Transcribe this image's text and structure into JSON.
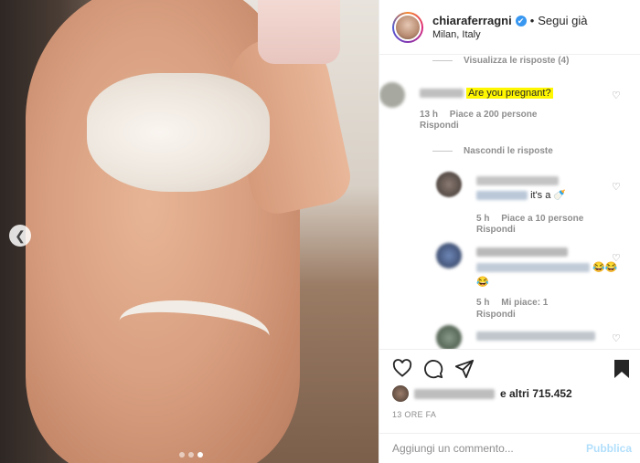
{
  "post": {
    "username": "chiaraferragni",
    "verified_mark": "✔",
    "separator": "•",
    "follow_status": "Segui già",
    "location": "Milan, Italy"
  },
  "comments": {
    "view_replies": "Visualizza le risposte (4)",
    "hide_replies": "Nascondi le risposte",
    "main": {
      "text": "Are you pregnant?",
      "time": "13 h",
      "likes": "Piace a 200 persone",
      "reply": "Rispondi"
    },
    "replies": [
      {
        "text": "it's a",
        "emoji": "🍼",
        "time": "5 h",
        "likes": "Piace a 10 persone",
        "reply": "Rispondi"
      },
      {
        "emoji": "😂😂",
        "emoji2": "😂",
        "time": "5 h",
        "likes": "Mi piace: 1",
        "reply": "Rispondi"
      }
    ]
  },
  "likes_summary": "e altri 715.452",
  "timestamp": "13 ORE FA",
  "add_comment": {
    "placeholder": "Aggiungi un commento...",
    "publish": "Pubblica"
  },
  "icons": {
    "heart": "heart-icon",
    "comment": "comment-icon",
    "share": "share-icon",
    "save": "bookmark-icon",
    "prev": "chevron-left-icon"
  },
  "colors": {
    "verified": "#3897f0",
    "highlight": "#fff700",
    "publish": "#b2dffc",
    "muted": "#8e8e8e"
  }
}
